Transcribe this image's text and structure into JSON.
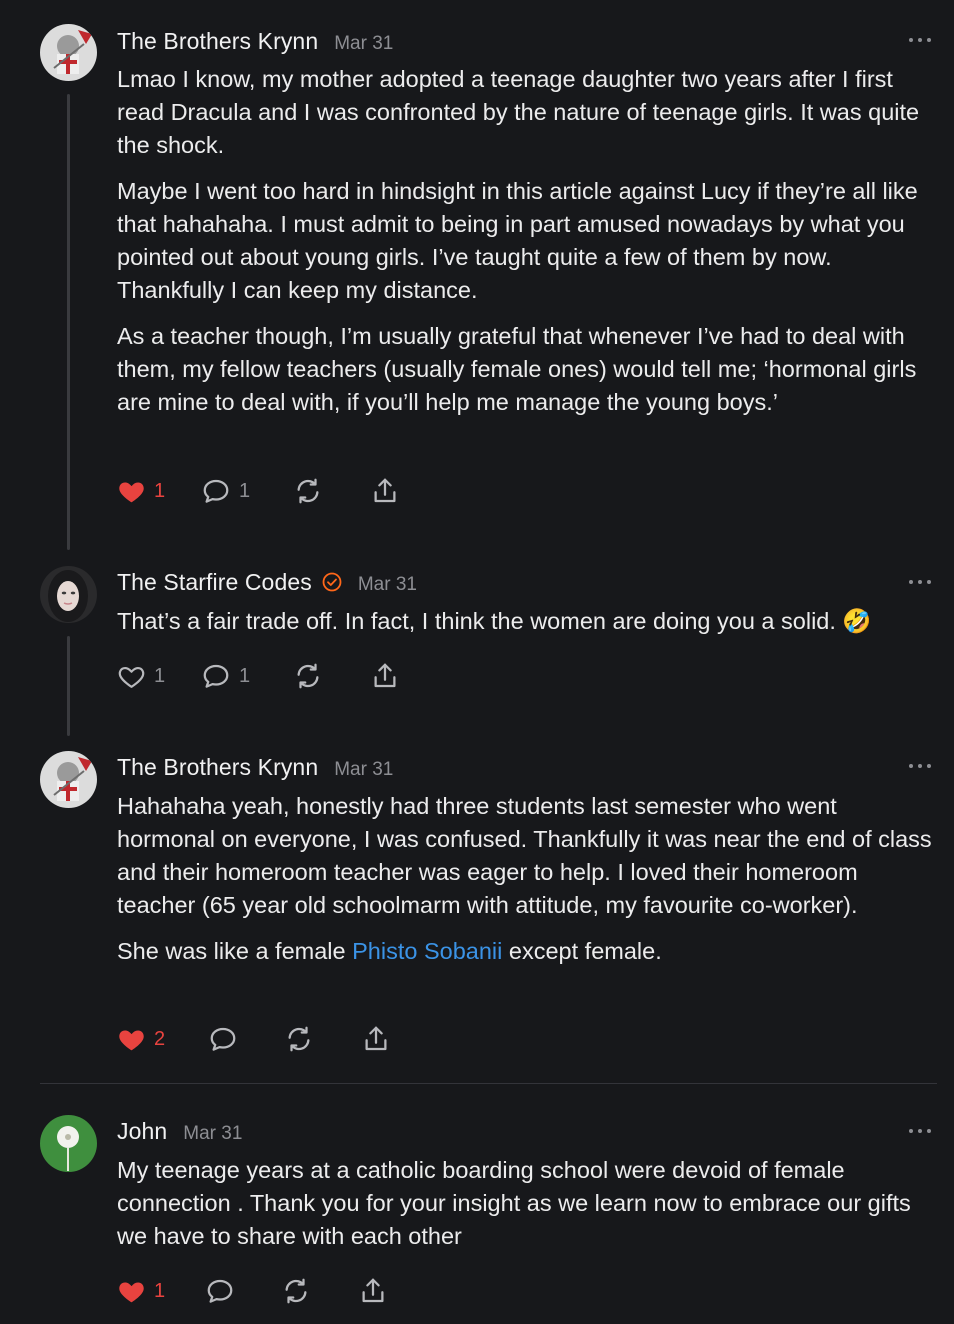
{
  "comments": [
    {
      "author": "The Brothers Krynn",
      "date": "Mar 31",
      "avatar": "knight-avatar",
      "paragraphs": [
        "Lmao I know, my mother adopted a teenage daughter two years after I first read Dracula and I was confronted by the nature of teenage girls. It was quite the shock.",
        "Maybe I went too hard in hindsight in this article against Lucy if they’re all like that hahahaha. I must admit to being in part amused nowadays by what you pointed out about young girls. I’ve taught quite a few of them by now. Thankfully I can keep my distance.",
        "As a teacher though, I’m usually grateful that whenever I’ve had to deal with them, my fellow teachers (usually female ones) would tell me; ‘hormonal girls are mine to deal with, if you’ll help me manage the young boys.’"
      ],
      "likes": "1",
      "liked": true,
      "replies": "1"
    },
    {
      "author": "The Starfire Codes",
      "date": "Mar 31",
      "avatar": "woman-portrait-avatar",
      "verified_icon": "verified-badge-icon",
      "paragraphs": [
        "That’s a fair trade off. In fact, I think the women are doing you a solid. 🤣"
      ],
      "likes": "1",
      "liked": false,
      "replies": "1"
    },
    {
      "author": "The Brothers Krynn",
      "date": "Mar 31",
      "avatar": "knight-avatar",
      "paragraphs": [
        "Hahahaha yeah, honestly had three students last semester who went hormonal on everyone, I was confused. Thankfully it was near the end of class and their homeroom teacher was eager to help. I loved their homeroom teacher (65 year old schoolmarm with attitude, my favourite co-worker)."
      ],
      "last_paragraph": {
        "before": "She was like a female ",
        "link": "Phisto Sobanii",
        "after": " except female."
      },
      "likes": "2",
      "liked": true,
      "replies": ""
    },
    {
      "author": "John",
      "date": "Mar 31",
      "avatar": "dandelion-avatar",
      "paragraphs": [
        "My teenage years at a catholic boarding school were devoid of female connection . Thank you for your insight as we learn now to embrace our gifts we have to share with each other"
      ],
      "likes": "1",
      "liked": true,
      "replies": ""
    }
  ],
  "colors": {
    "background": "#17181b",
    "heart_red": "#e8433f",
    "link_blue": "#3b93e6",
    "verified_orange": "#ff6719",
    "muted": "#8d8e93"
  }
}
